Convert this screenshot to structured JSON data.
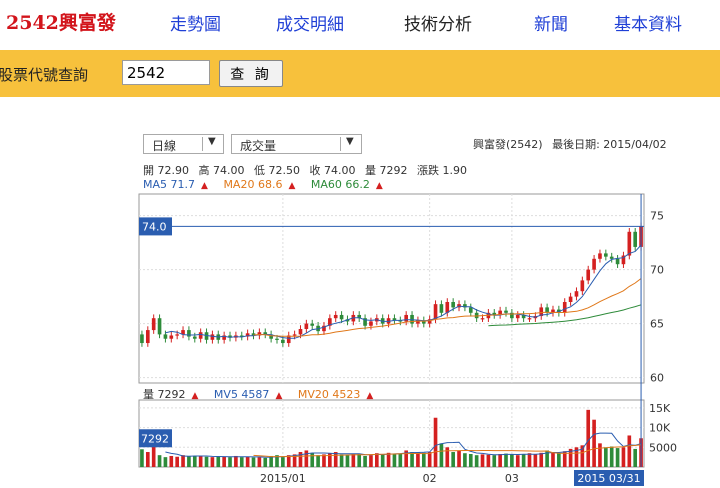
{
  "nav": {
    "brand": "2542興富發",
    "links": [
      "走勢圖",
      "成交明細",
      "技術分析",
      "新聞",
      "基本資料"
    ]
  },
  "search": {
    "label": "股票代號查詢",
    "value": "2542",
    "button": "查 詢"
  },
  "controls": {
    "period": "日線",
    "indicator": "成交量"
  },
  "header": {
    "stock": "興富發(2542)",
    "last_date_label": "最後日期: 2015/04/02"
  },
  "quote": {
    "open": "開 72.90",
    "high": "高 74.00",
    "low": "低 72.50",
    "close": "收 74.00",
    "volume": "量 7292",
    "change": "漲跌 1.90"
  },
  "ma": {
    "ma5": "MA5 71.7",
    "ma20": "MA20 68.6",
    "ma60": "MA60 66.2"
  },
  "vol_info": {
    "vol": "量 7292",
    "mv5": "MV5 4587",
    "mv20": "MV20 4523"
  },
  "colors": {
    "up": "#d42020",
    "down": "#2e8b3a",
    "ma5": "#2a5db0",
    "ma20": "#e0781a",
    "ma60": "#2e8b3a",
    "marker": "#2a5db0"
  },
  "chart_data": {
    "type": "candlestick",
    "price_axis": {
      "ylim": [
        59.5,
        77
      ],
      "ticks": [
        60,
        65,
        70,
        75
      ]
    },
    "volume_axis": {
      "ylim": [
        0,
        17000
      ],
      "ticks": [
        5000,
        10000,
        15000
      ],
      "tick_labels": [
        "5000",
        "10K",
        "15K"
      ]
    },
    "x_tick_labels": [
      {
        "i": 24,
        "label": "2015/01"
      },
      {
        "i": 49,
        "label": "02"
      },
      {
        "i": 63,
        "label": "03"
      }
    ],
    "crosshair": {
      "price_label": "74.0",
      "volume_label": "7292",
      "date_label": "2015 03/31"
    },
    "closes": [
      63.2,
      64.4,
      65.5,
      64.0,
      63.6,
      63.9,
      64.0,
      64.4,
      63.8,
      63.6,
      64.2,
      63.5,
      64.0,
      63.5,
      63.9,
      63.7,
      63.9,
      63.8,
      64.1,
      63.9,
      64.2,
      64.0,
      63.6,
      63.5,
      63.2,
      63.9,
      64.0,
      64.5,
      65.0,
      64.8,
      64.3,
      64.8,
      65.5,
      65.8,
      65.4,
      65.2,
      65.8,
      65.5,
      64.8,
      65.2,
      65.5,
      65.0,
      65.5,
      65.3,
      65.2,
      65.8,
      65.0,
      65.3,
      65.0,
      65.4,
      66.8,
      66.0,
      67.0,
      66.5,
      66.8,
      66.5,
      66.0,
      65.5,
      65.5,
      66.0,
      65.8,
      66.2,
      66.0,
      65.5,
      65.8,
      65.5,
      65.5,
      65.7,
      66.5,
      66.0,
      66.3,
      66.0,
      67.0,
      67.5,
      68.0,
      69.0,
      70.0,
      71.0,
      71.5,
      71.2,
      71.0,
      70.5,
      71.3,
      73.5,
      72.1,
      74.0
    ],
    "volumes": [
      4500,
      3800,
      5200,
      3000,
      2500,
      2800,
      2600,
      3000,
      2800,
      2700,
      2800,
      2600,
      2500,
      2700,
      2600,
      2500,
      2800,
      2500,
      2600,
      2400,
      2500,
      2300,
      2800,
      3000,
      2500,
      3000,
      3200,
      3800,
      4200,
      3500,
      3000,
      3200,
      3500,
      3800,
      3200,
      3000,
      3400,
      3300,
      2800,
      3000,
      3500,
      3200,
      3600,
      3300,
      3400,
      4200,
      3800,
      3700,
      3600,
      3800,
      12500,
      6000,
      5000,
      3800,
      4200,
      3500,
      3300,
      3000,
      3200,
      3100,
      3000,
      3300,
      3400,
      3200,
      3000,
      3200,
      3500,
      3300,
      3600,
      4200,
      3800,
      3500,
      4000,
      4600,
      5000,
      5500,
      14500,
      12000,
      6000,
      5000,
      5200,
      4800,
      5000,
      8000,
      4587,
      7292
    ]
  }
}
